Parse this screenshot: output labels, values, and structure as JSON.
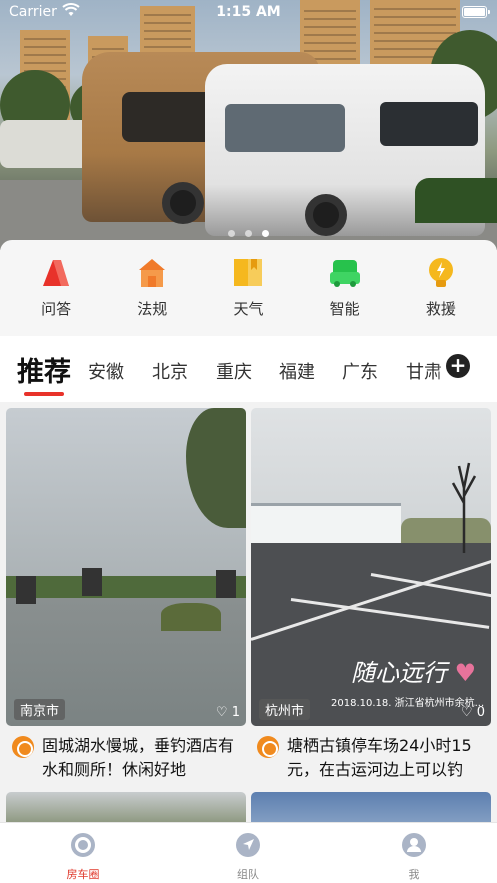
{
  "status_bar": {
    "carrier": "Carrier",
    "time": "1:15 AM"
  },
  "banner": {
    "pages": 3,
    "active_page": 3
  },
  "quick_actions": [
    {
      "label": "问答",
      "icon": "qa-icon",
      "color": "#e8322a"
    },
    {
      "label": "法规",
      "icon": "regulations-house-icon",
      "color": "#f07a2a"
    },
    {
      "label": "天气",
      "icon": "weather-book-icon",
      "color": "#f5b81e"
    },
    {
      "label": "智能",
      "icon": "smart-car-icon",
      "color": "#27c24c"
    },
    {
      "label": "救援",
      "icon": "rescue-lightbulb-icon",
      "color": "#f5b81e"
    }
  ],
  "tabs": {
    "items": [
      "推荐",
      "安徽",
      "北京",
      "重庆",
      "福建",
      "广东",
      "甘肃"
    ],
    "active": "推荐",
    "add_label": "+"
  },
  "feed": [
    {
      "city": "南京市",
      "likes": "1",
      "title": "固城湖水慢城，垂钓酒店有水和厕所！休闲好地"
    },
    {
      "city": "杭州市",
      "likes": "0",
      "title": "塘栖古镇停车场24小时15元，在古运河边上可以钓",
      "photo_signature": "随心远行",
      "photo_caption": "2018.10.18.  浙江省杭州市余杭..."
    }
  ],
  "bottom_nav": [
    {
      "label": "房车圈",
      "icon": "circle-target-icon",
      "active": true
    },
    {
      "label": "组队",
      "icon": "navigation-arrow-icon",
      "active": false
    },
    {
      "label": "我",
      "icon": "user-profile-icon",
      "active": false
    }
  ],
  "colors": {
    "accent": "#e8322a",
    "nav_active": "#e03b2e",
    "logo": "#f08a1e"
  }
}
